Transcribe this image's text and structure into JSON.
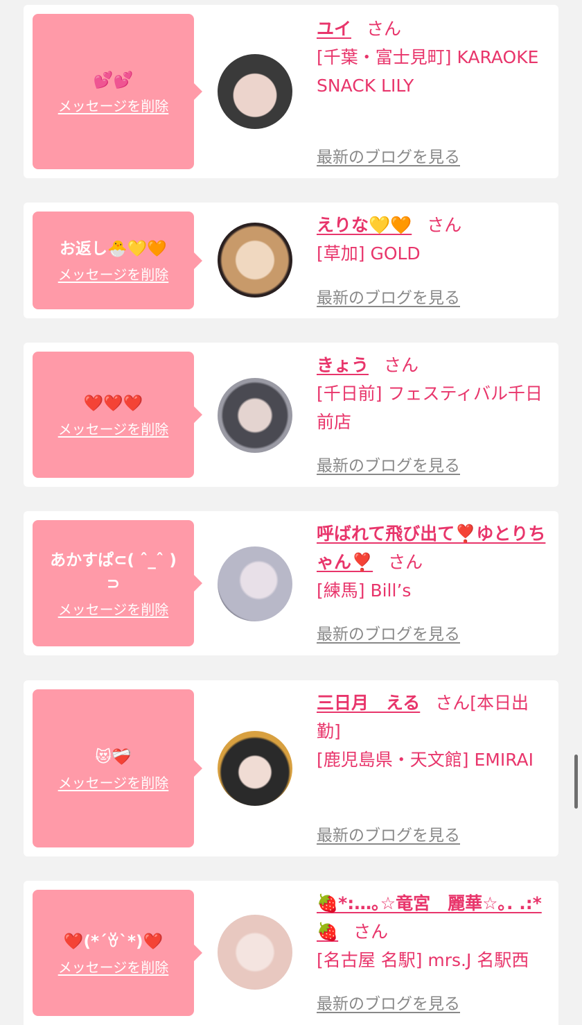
{
  "entries": [
    {
      "message": "💕💕",
      "delete_label": "メッセージを削除",
      "name": "ユイ",
      "honorific": "さん",
      "shop": "[千葉・富士見町] KARAOKE SNACK LILY",
      "blog_label": "最新のブログを見る",
      "avatar_colors": [
        "#3a3a3a",
        "#e8d2c8"
      ]
    },
    {
      "message": "お返し🐣💛🧡",
      "delete_label": "メッセージを削除",
      "name": "えりな💛🧡",
      "honorific": "さん",
      "shop": "[草加] GOLD",
      "blog_label": "最新のブログを見る",
      "avatar_colors": [
        "#c89a6a",
        "#f0d8c0"
      ]
    },
    {
      "message": "❤️❤️❤️",
      "delete_label": "メッセージを削除",
      "name": "きょう",
      "honorific": "さん",
      "shop": "[千日前] フェスティバル千日前店",
      "blog_label": "最新のブログを見る",
      "avatar_colors": [
        "#5a5a60",
        "#d8c8c8"
      ]
    },
    {
      "message": "あかすぱ⊂( ˆ_ˆ )⊃",
      "delete_label": "メッセージを削除",
      "name": "呼ばれて飛び出て❣️ゆとりちゃん❣️",
      "honorific": "さん",
      "shop": "[練馬] Bill’s",
      "blog_label": "最新のブログを見る",
      "avatar_colors": [
        "#b8b8c8",
        "#e8e0e8"
      ]
    },
    {
      "message": "😻❤️‍🩹",
      "delete_label": "メッセージを削除",
      "name": "三日月　える",
      "honorific": "さん[本日出勤]",
      "shop": "[鹿児島県・天文館] EMIRAI",
      "blog_label": "最新のブログを見る",
      "avatar_colors": [
        "#d8a040",
        "#2a2a2a"
      ]
    },
    {
      "message": "❤️(*´ꈊ`*)❤️",
      "delete_label": "メッセージを削除",
      "name": "🍓*:…｡☆竜宮　麗華☆｡. .:*🍓",
      "honorific": "さん",
      "shop": "[名古屋 名駅] mrs.J 名駅西",
      "blog_label": "最新のブログを見る",
      "avatar_colors": [
        "#e8c8c0",
        "#f4e4e0"
      ]
    }
  ]
}
